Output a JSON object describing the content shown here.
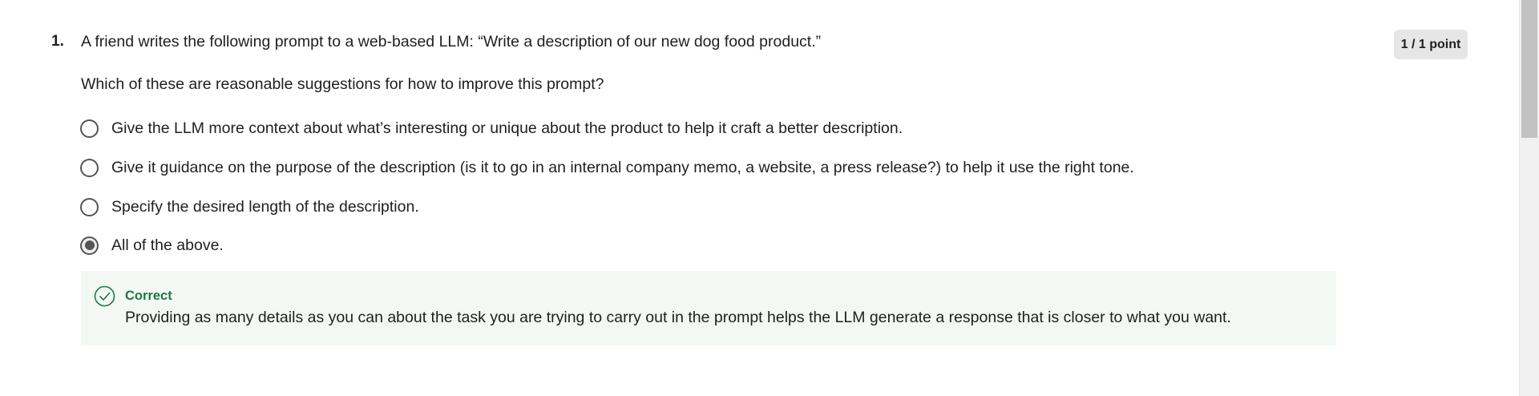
{
  "question": {
    "number": "1.",
    "prompt": "A friend writes the following prompt to a web-based LLM: “Write a description of our new dog food product.”",
    "subprompt": "Which of these are reasonable suggestions for how to improve this prompt?",
    "points": "1 / 1 point",
    "options": [
      {
        "label": "Give the LLM more context about what’s interesting or unique about the product to help it craft a better description.",
        "selected": false
      },
      {
        "label": "Give it guidance on the purpose of the description (is it to go in an internal company memo, a website, a press release?) to help it use the right tone.",
        "selected": false
      },
      {
        "label": "Specify the desired length of the description.",
        "selected": false
      },
      {
        "label": "All of the above.",
        "selected": true
      }
    ]
  },
  "feedback": {
    "status": "Correct",
    "icon": "check-circle-icon",
    "text": "Providing as many details as you can about the task you are trying to carry out in the prompt helps the LLM generate a response that is closer to what you want.",
    "accent_color": "#1e7a45",
    "background_color": "#f3f8f5"
  }
}
